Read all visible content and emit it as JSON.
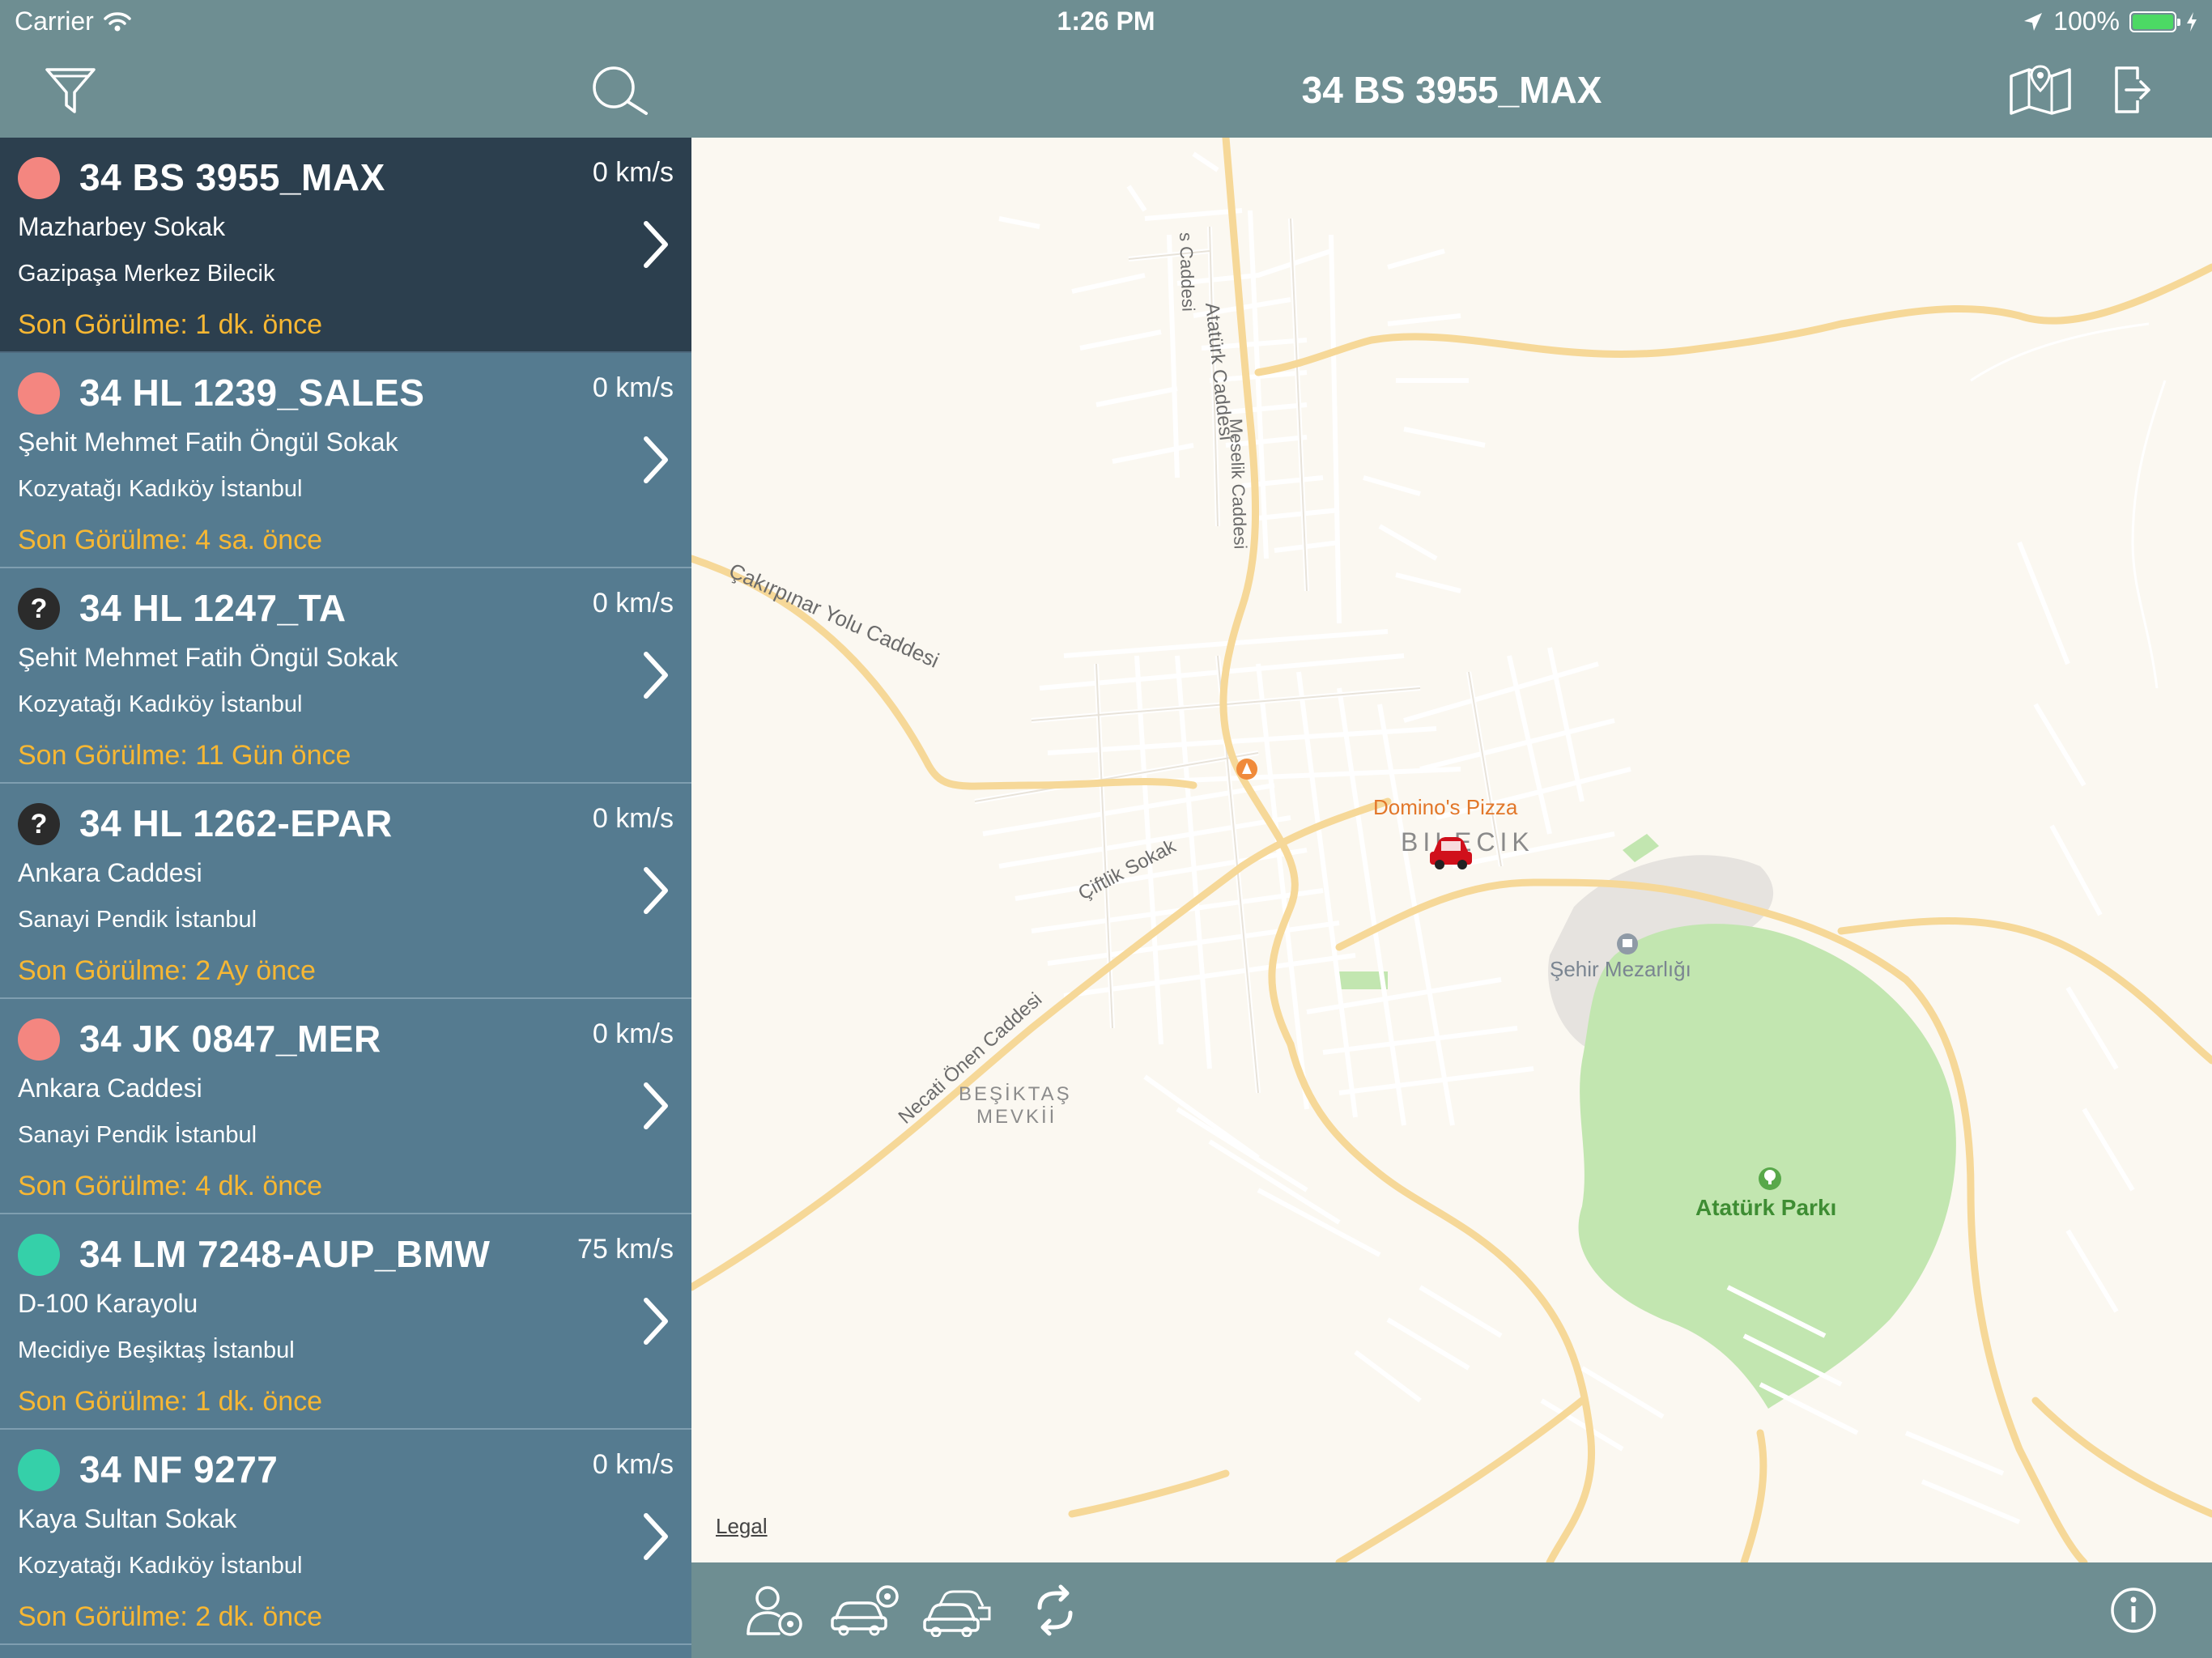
{
  "status_bar": {
    "carrier": "Carrier",
    "time": "1:26 PM",
    "battery_percent": "100%",
    "battery_level": 1.0
  },
  "colors": {
    "header": "#6e8e92",
    "list_bg": "#557b90",
    "selected_bg": "#2c3f4e",
    "last_seen": "#f7b733",
    "status_red": "#f48680",
    "status_green": "#35d0a9",
    "status_unknown": "#2b2b2b"
  },
  "left_header": {
    "filter_icon": "filter-icon",
    "search_icon": "search-icon"
  },
  "vehicles": [
    {
      "plate": "34 BS 3955_MAX",
      "speed": "0 km/s",
      "street": "Mazharbey Sokak",
      "district": "Gazipaşa Merkez Bilecik",
      "last_seen": "Son Görülme: 1 dk. önce",
      "status": "red",
      "status_symbol": "",
      "selected": true
    },
    {
      "plate": "34 HL 1239_SALES",
      "speed": "0 km/s",
      "street": "Şehit Mehmet Fatih Öngül Sokak",
      "district": "Kozyatağı Kadıköy İstanbul",
      "last_seen": "Son Görülme: 4 sa. önce",
      "status": "red",
      "status_symbol": "",
      "selected": false
    },
    {
      "plate": "34 HL 1247_TA",
      "speed": "0 km/s",
      "street": "Şehit Mehmet Fatih Öngül Sokak",
      "district": "Kozyatağı Kadıköy İstanbul",
      "last_seen": "Son Görülme: 11 Gün önce",
      "status": "unknown",
      "status_symbol": "?",
      "selected": false
    },
    {
      "plate": "34 HL 1262-EPAR",
      "speed": "0 km/s",
      "street": "Ankara Caddesi",
      "district": "Sanayi Pendik İstanbul",
      "last_seen": "Son Görülme: 2 Ay önce",
      "status": "unknown",
      "status_symbol": "?",
      "selected": false
    },
    {
      "plate": "34 JK 0847_MER",
      "speed": "0 km/s",
      "street": "Ankara Caddesi",
      "district": "Sanayi Pendik İstanbul",
      "last_seen": "Son Görülme: 4 dk. önce",
      "status": "red",
      "status_symbol": "",
      "selected": false
    },
    {
      "plate": "34 LM 7248-AUP_BMW",
      "speed": "75 km/s",
      "street": "D-100 Karayolu",
      "district": "Mecidiye Beşiktaş İstanbul",
      "last_seen": "Son Görülme: 1 dk. önce",
      "status": "green",
      "status_symbol": "",
      "selected": false
    },
    {
      "plate": "34 NF 9277",
      "speed": "0 km/s",
      "street": "Kaya Sultan Sokak",
      "district": "Kozyatağı Kadıköy İstanbul",
      "last_seen": "Son Görülme: 2 dk. önce",
      "status": "green",
      "status_symbol": "",
      "selected": false
    }
  ],
  "detail_header": {
    "title": "34 BS 3955_MAX",
    "map_mode_icon": "map-icon",
    "exit_icon": "logout-icon"
  },
  "map": {
    "labels": {
      "road_cakirpinar": "Çakırpınar Yolu Caddesi",
      "road_ataturk": "Atatürk Caddesi",
      "road_meselik": "Meselik Caddesi",
      "road_s_caddesi": "s Caddesi",
      "road_ciftlik": "Çiftlik Sokak",
      "road_necati": "Necati Önen Caddesi",
      "poi_dominos": "Domino's Pizza",
      "city_bilecik": "BILECIK",
      "poi_cemetery": "Şehir Mezarlığı",
      "area_besiktas_1": "BEŞİKTAŞ",
      "area_besiktas_2": "MEVKİİ",
      "park_ataturk": "Atatürk Parkı"
    },
    "legal": "Legal",
    "marker_icon": "car-marker-icon"
  },
  "bottom_toolbar": {
    "items": [
      "user-location-icon",
      "vehicle-location-icon",
      "all-vehicles-icon",
      "refresh-icon",
      "info-icon"
    ]
  }
}
